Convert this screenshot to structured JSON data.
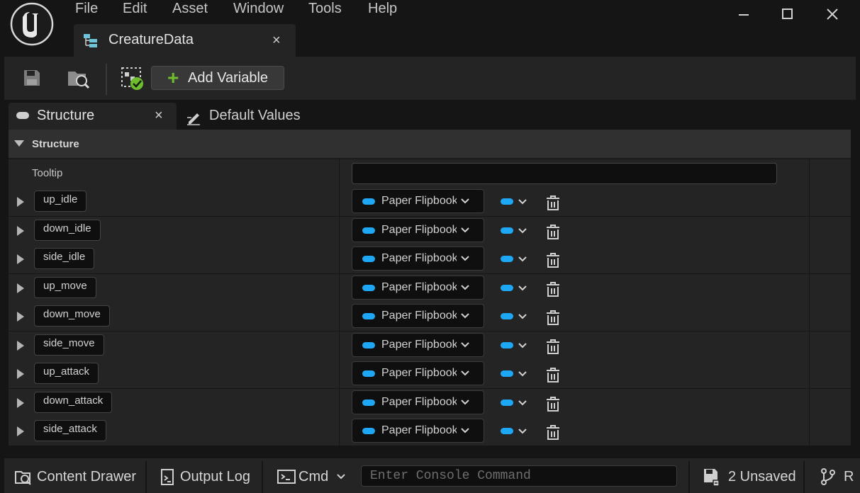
{
  "menu": {
    "items": [
      "File",
      "Edit",
      "Asset",
      "Window",
      "Tools",
      "Help"
    ]
  },
  "asset_tab": {
    "title": "CreatureData",
    "close": "×"
  },
  "toolbar": {
    "save_icon": "save-icon",
    "browse_icon": "browse-in-content-browser-icon",
    "apply_icon": "apply-checkmark-icon",
    "add_variable_label": "Add Variable"
  },
  "panel_tabs": {
    "structure": "Structure",
    "structure_close": "×",
    "default_values": "Default Values"
  },
  "details": {
    "section_title": "Structure",
    "tooltip_label": "Tooltip",
    "tooltip_value": "",
    "variables": [
      {
        "name": "up_idle",
        "type": "Paper Flipbook"
      },
      {
        "name": "down_idle",
        "type": "Paper Flipbook"
      },
      {
        "name": "side_idle",
        "type": "Paper Flipbook"
      },
      {
        "name": "up_move",
        "type": "Paper Flipbook"
      },
      {
        "name": "down_move",
        "type": "Paper Flipbook"
      },
      {
        "name": "side_move",
        "type": "Paper Flipbook"
      },
      {
        "name": "up_attack",
        "type": "Paper Flipbook"
      },
      {
        "name": "down_attack",
        "type": "Paper Flipbook"
      },
      {
        "name": "side_attack",
        "type": "Paper Flipbook"
      }
    ],
    "type_pill_color": "#1ea7f5"
  },
  "statusbar": {
    "content_drawer": "Content Drawer",
    "output_log": "Output Log",
    "cmd": "Cmd",
    "console_placeholder": "Enter Console Command",
    "unsaved": "2 Unsaved",
    "revision": "R"
  },
  "colors": {
    "background": "#151515",
    "panel": "#242424",
    "accent_green": "#6fbc2f",
    "accent_blue": "#1ea7f5"
  }
}
